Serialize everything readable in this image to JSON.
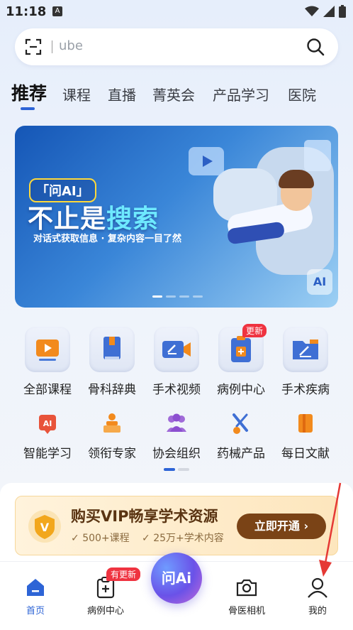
{
  "status_bar": {
    "time": "11:18",
    "notification_glyph": "A"
  },
  "search": {
    "placeholder": "ube"
  },
  "tabs": [
    {
      "label": "推荐",
      "active": true
    },
    {
      "label": "课程"
    },
    {
      "label": "直播"
    },
    {
      "label": "菁英会"
    },
    {
      "label": "产品学习"
    },
    {
      "label": "医院"
    }
  ],
  "banner": {
    "badge": "「问AI」",
    "title_main": "不止是",
    "title_highlight": "搜索",
    "subtitle": "对话式获取信息 · 复杂内容一目了然",
    "ai_tag": "AI",
    "slide_count": 4,
    "active_slide": 1
  },
  "quick_actions": {
    "row1": [
      {
        "label": "全部课程",
        "icon": "tv-play-icon"
      },
      {
        "label": "骨科辞典",
        "icon": "book-icon"
      },
      {
        "label": "手术视频",
        "icon": "video-camera-icon"
      },
      {
        "label": "病例中心",
        "icon": "clipboard-plus-icon",
        "badge": "更新"
      },
      {
        "label": "手术疾病",
        "icon": "folder-edit-icon"
      }
    ],
    "row2": [
      {
        "label": "智能学习",
        "icon": "ai-chip-icon",
        "icon_text": "AI"
      },
      {
        "label": "领衔专家",
        "icon": "expert-podium-icon"
      },
      {
        "label": "协会组织",
        "icon": "group-icon"
      },
      {
        "label": "药械产品",
        "icon": "pill-syringe-icon"
      },
      {
        "label": "每日文献",
        "icon": "document-book-icon"
      }
    ]
  },
  "vip": {
    "title": "购买VIP畅享学术资源",
    "feature1": "500+课程",
    "feature2": "25万+学术内容",
    "button": "立即开通",
    "shield_letter": "V"
  },
  "bottom_nav": {
    "home": "首页",
    "cases": "病例中心",
    "cases_badge": "有更新",
    "ai": "问Ai",
    "camera": "骨医相机",
    "mine": "我的"
  },
  "colors": {
    "accent": "#2d64d6",
    "badge_red": "#ef3340",
    "vip_brown": "#7a4316"
  }
}
